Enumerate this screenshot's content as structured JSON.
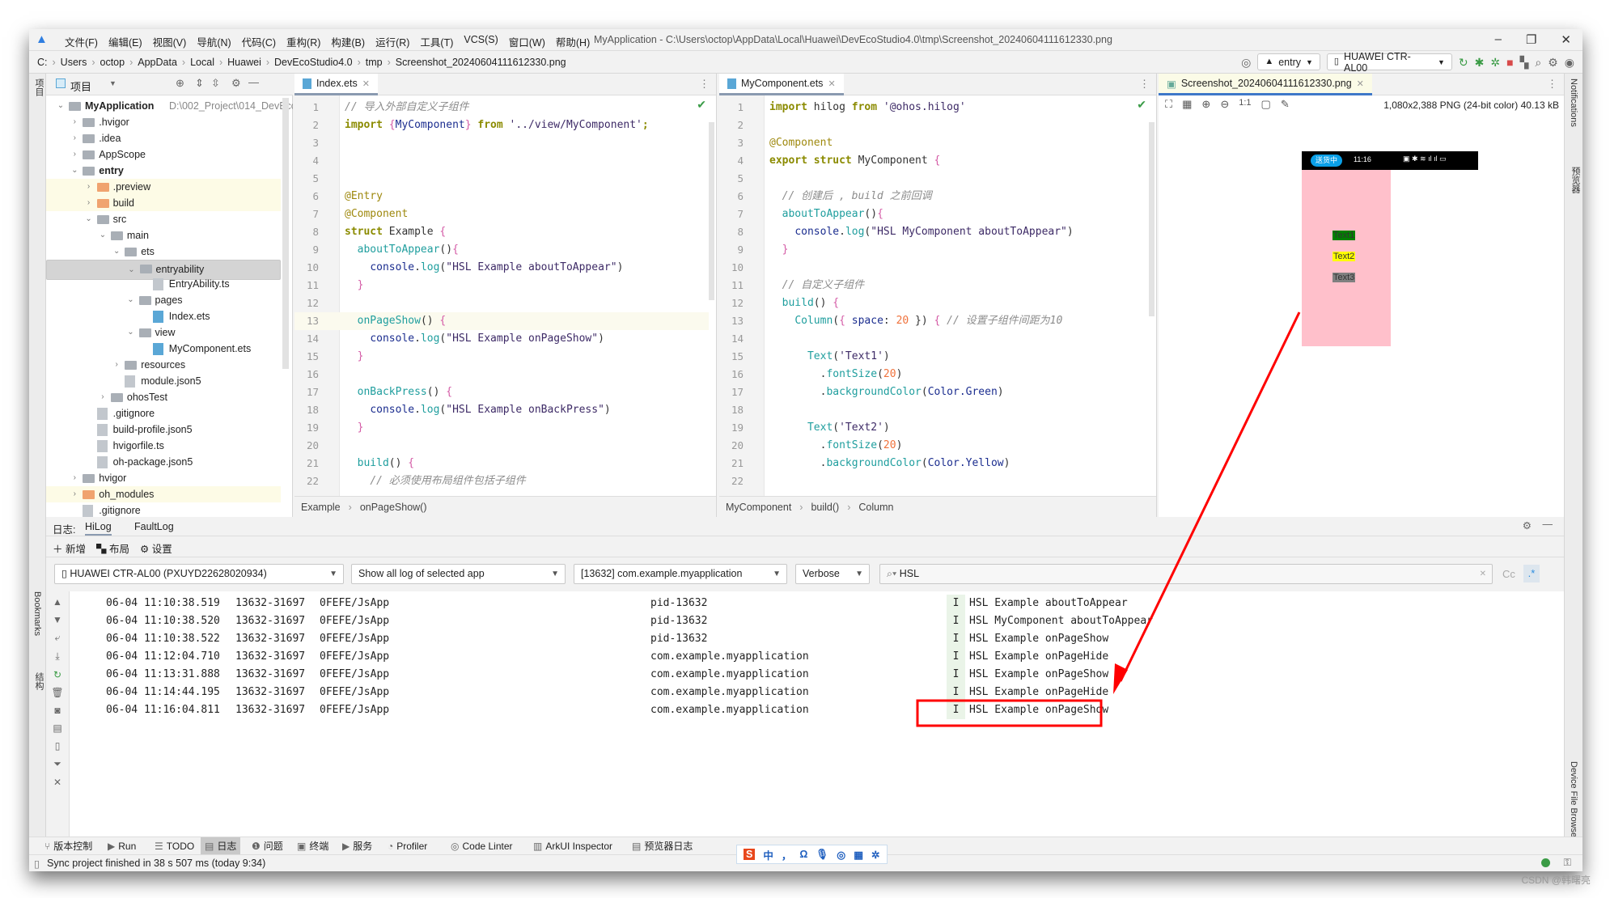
{
  "menu": [
    "文件(F)",
    "编辑(E)",
    "视图(V)",
    "导航(N)",
    "代码(C)",
    "重构(R)",
    "构建(B)",
    "运行(R)",
    "工具(T)",
    "VCS(S)",
    "窗口(W)",
    "帮助(H)"
  ],
  "window_title": "MyApplication - C:\\Users\\octop\\AppData\\Local\\Huawei\\DevEcoStudio4.0\\tmp\\Screenshot_20240604111612330.png",
  "breadcrumb": [
    "C:",
    "Users",
    "octop",
    "AppData",
    "Local",
    "Huawei",
    "DevEcoStudio4.0",
    "tmp",
    "Screenshot_20240604111612330.png"
  ],
  "run_config": "entry",
  "device": "HUAWEI CTR-AL00",
  "project_panel": {
    "title": "项目",
    "root_path": "D:\\002_Project\\014_DevEcoSt"
  },
  "tree": [
    {
      "label": "MyApplication",
      "level": 0,
      "type": "module",
      "open": true,
      "bold": true
    },
    {
      "label": ".hvigor",
      "level": 1,
      "type": "folder"
    },
    {
      "label": ".idea",
      "level": 1,
      "type": "folder"
    },
    {
      "label": "AppScope",
      "level": 1,
      "type": "folder"
    },
    {
      "label": "entry",
      "level": 1,
      "type": "module",
      "open": true,
      "bold": true
    },
    {
      "label": ".preview",
      "level": 2,
      "type": "folder-orange",
      "hl": true
    },
    {
      "label": "build",
      "level": 2,
      "type": "folder-orange",
      "hl": true
    },
    {
      "label": "src",
      "level": 2,
      "type": "folder",
      "open": true
    },
    {
      "label": "main",
      "level": 3,
      "type": "folder",
      "open": true
    },
    {
      "label": "ets",
      "level": 4,
      "type": "folder",
      "open": true
    },
    {
      "label": "entryability",
      "level": 5,
      "type": "folder",
      "open": true,
      "selected": true
    },
    {
      "label": "EntryAbility.ts",
      "level": 6,
      "type": "ts"
    },
    {
      "label": "pages",
      "level": 5,
      "type": "folder",
      "open": true
    },
    {
      "label": "Index.ets",
      "level": 6,
      "type": "ets"
    },
    {
      "label": "view",
      "level": 5,
      "type": "folder",
      "open": true
    },
    {
      "label": "MyComponent.ets",
      "level": 6,
      "type": "ets"
    },
    {
      "label": "resources",
      "level": 4,
      "type": "folder"
    },
    {
      "label": "module.json5",
      "level": 4,
      "type": "json"
    },
    {
      "label": "ohosTest",
      "level": 3,
      "type": "folder"
    },
    {
      "label": ".gitignore",
      "level": 2,
      "type": "file"
    },
    {
      "label": "build-profile.json5",
      "level": 2,
      "type": "json"
    },
    {
      "label": "hvigorfile.ts",
      "level": 2,
      "type": "ts"
    },
    {
      "label": "oh-package.json5",
      "level": 2,
      "type": "json"
    },
    {
      "label": "hvigor",
      "level": 1,
      "type": "folder"
    },
    {
      "label": "oh_modules",
      "level": 1,
      "type": "folder-orange",
      "hl": true
    },
    {
      "label": ".gitignore",
      "level": 1,
      "type": "file"
    }
  ],
  "editor1": {
    "tab": "Index.ets",
    "current_line": 13,
    "breadcrumb": [
      "Example",
      "onPageShow()"
    ],
    "lines": [
      [
        [
          "cm",
          "// 导入外部自定义子组件"
        ]
      ],
      [
        [
          "kw",
          "import "
        ],
        [
          "br",
          "{"
        ],
        [
          "pl",
          "MyComponent"
        ],
        [
          "br",
          "}"
        ],
        [
          "kw",
          " from "
        ],
        [
          "st",
          "'../view/MyComponent'"
        ],
        [
          "kw",
          ";"
        ]
      ],
      [],
      [],
      [],
      [
        [
          "an",
          "@Entry"
        ]
      ],
      [
        [
          "an",
          "@Component"
        ]
      ],
      [
        [
          "kw",
          "struct "
        ],
        [
          "tx",
          "Example "
        ],
        [
          "br",
          "{"
        ]
      ],
      [
        [
          "tx",
          "  "
        ],
        [
          "fn",
          "aboutToAppear"
        ],
        [
          "tx",
          "()"
        ],
        [
          "br",
          "{"
        ]
      ],
      [
        [
          "tx",
          "    "
        ],
        [
          "pl",
          "console"
        ],
        [
          "tx",
          "."
        ],
        [
          "fn",
          "log"
        ],
        [
          "tx",
          "("
        ],
        [
          "st",
          "\"HSL Example aboutToAppear\""
        ],
        [
          "tx",
          ")"
        ]
      ],
      [
        [
          "tx",
          "  "
        ],
        [
          "br",
          "}"
        ]
      ],
      [],
      [
        [
          "tx",
          "  "
        ],
        [
          "fn",
          "onPageShow"
        ],
        [
          "tx",
          "() "
        ],
        [
          "br",
          "{"
        ]
      ],
      [
        [
          "tx",
          "    "
        ],
        [
          "pl",
          "console"
        ],
        [
          "tx",
          "."
        ],
        [
          "fn",
          "log"
        ],
        [
          "tx",
          "("
        ],
        [
          "st",
          "\"HSL Example onPageShow\""
        ],
        [
          "tx",
          ")"
        ]
      ],
      [
        [
          "tx",
          "  "
        ],
        [
          "br",
          "}"
        ]
      ],
      [],
      [
        [
          "tx",
          "  "
        ],
        [
          "fn",
          "onBackPress"
        ],
        [
          "tx",
          "() "
        ],
        [
          "br",
          "{"
        ]
      ],
      [
        [
          "tx",
          "    "
        ],
        [
          "pl",
          "console"
        ],
        [
          "tx",
          "."
        ],
        [
          "fn",
          "log"
        ],
        [
          "tx",
          "("
        ],
        [
          "st",
          "\"HSL Example onBackPress\""
        ],
        [
          "tx",
          ")"
        ]
      ],
      [
        [
          "tx",
          "  "
        ],
        [
          "br",
          "}"
        ]
      ],
      [],
      [
        [
          "tx",
          "  "
        ],
        [
          "fn",
          "build"
        ],
        [
          "tx",
          "() "
        ],
        [
          "br",
          "{"
        ]
      ],
      [
        [
          "tx",
          "    "
        ],
        [
          "cm",
          "// 必须使用布局组件包括子组件"
        ]
      ]
    ]
  },
  "editor2": {
    "tab": "MyComponent.ets",
    "breadcrumb": [
      "MyComponent",
      "build()",
      "Column"
    ],
    "lines": [
      [
        [
          "kw",
          "import "
        ],
        [
          "tx",
          "hilog "
        ],
        [
          "kw",
          "from "
        ],
        [
          "st",
          "'@ohos.hilog'"
        ]
      ],
      [],
      [
        [
          "an",
          "@Component"
        ]
      ],
      [
        [
          "kw",
          "export struct "
        ],
        [
          "tx",
          "MyComponent "
        ],
        [
          "br",
          "{"
        ]
      ],
      [],
      [
        [
          "tx",
          "  "
        ],
        [
          "cm",
          "// 创建后 , build 之前回调"
        ]
      ],
      [
        [
          "tx",
          "  "
        ],
        [
          "fn",
          "aboutToAppear"
        ],
        [
          "tx",
          "()"
        ],
        [
          "br",
          "{"
        ]
      ],
      [
        [
          "tx",
          "    "
        ],
        [
          "pl",
          "console"
        ],
        [
          "tx",
          "."
        ],
        [
          "fn",
          "log"
        ],
        [
          "tx",
          "("
        ],
        [
          "st",
          "\"HSL MyComponent aboutToAppear\""
        ],
        [
          "tx",
          ")"
        ]
      ],
      [
        [
          "tx",
          "  "
        ],
        [
          "br",
          "}"
        ]
      ],
      [],
      [
        [
          "tx",
          "  "
        ],
        [
          "cm",
          "// 自定义子组件"
        ]
      ],
      [
        [
          "tx",
          "  "
        ],
        [
          "fn",
          "build"
        ],
        [
          "tx",
          "() "
        ],
        [
          "br",
          "{"
        ]
      ],
      [
        [
          "tx",
          "    "
        ],
        [
          "fn",
          "Column"
        ],
        [
          "tx",
          "("
        ],
        [
          "br",
          "{"
        ],
        [
          "pl",
          " space"
        ],
        [
          "tx",
          ": "
        ],
        [
          "nu",
          "20"
        ],
        [
          "tx",
          " }) "
        ],
        [
          "br",
          "{"
        ],
        [
          "cm",
          " // 设置子组件间距为10"
        ]
      ],
      [],
      [
        [
          "tx",
          "      "
        ],
        [
          "fn",
          "Text"
        ],
        [
          "tx",
          "("
        ],
        [
          "st",
          "'Text1'"
        ],
        [
          "tx",
          ")"
        ]
      ],
      [
        [
          "tx",
          "        ."
        ],
        [
          "fn",
          "fontSize"
        ],
        [
          "tx",
          "("
        ],
        [
          "nu",
          "20"
        ],
        [
          "tx",
          ")"
        ]
      ],
      [
        [
          "tx",
          "        ."
        ],
        [
          "fn",
          "backgroundColor"
        ],
        [
          "tx",
          "("
        ],
        [
          "pl",
          "Color.Green"
        ],
        [
          "tx",
          ")"
        ]
      ],
      [],
      [
        [
          "tx",
          "      "
        ],
        [
          "fn",
          "Text"
        ],
        [
          "tx",
          "("
        ],
        [
          "st",
          "'Text2'"
        ],
        [
          "tx",
          ")"
        ]
      ],
      [
        [
          "tx",
          "        ."
        ],
        [
          "fn",
          "fontSize"
        ],
        [
          "tx",
          "("
        ],
        [
          "nu",
          "20"
        ],
        [
          "tx",
          ")"
        ]
      ],
      [
        [
          "tx",
          "        ."
        ],
        [
          "fn",
          "backgroundColor"
        ],
        [
          "tx",
          "("
        ],
        [
          "pl",
          "Color.Yellow"
        ],
        [
          "tx",
          ")"
        ]
      ],
      []
    ]
  },
  "image_viewer": {
    "tab": "Screenshot_20240604111612330.png",
    "info": "1,080x2,388 PNG (24-bit color) 40.13 kB",
    "phone": {
      "status_pill": "送货中",
      "time": "11:16",
      "texts": [
        {
          "label": "Text1",
          "bg": "#008000"
        },
        {
          "label": "Text2",
          "bg": "#ffff00"
        },
        {
          "label": "Text3",
          "bg": "#808080"
        }
      ],
      "bg": "#ffc0cb"
    }
  },
  "right_strip": [
    "Notifications",
    "预览器",
    "Device File Browser"
  ],
  "left_strip": [
    "项目",
    "Bookmarks",
    "结构"
  ],
  "log": {
    "label": "日志:",
    "tabs": [
      "HiLog",
      "FaultLog"
    ],
    "toolbar": [
      "新增",
      "布局",
      "设置"
    ],
    "device_filter": "HUAWEI CTR-AL00 (PXUYD22628020934)",
    "scope_filter": "Show all log of selected app",
    "process_filter": "[13632] com.example.myapplication",
    "level_filter": "Verbose",
    "search": "HSL",
    "case_btn": "Cc",
    "regex_btn": ".*",
    "rows": [
      {
        "time": "06-04 11:10:38.519",
        "pid": "13632-31697",
        "tag": "0FEFE/JsApp",
        "pkg": "pid-13632",
        "level": "I",
        "msg": "HSL Example aboutToAppear"
      },
      {
        "time": "06-04 11:10:38.520",
        "pid": "13632-31697",
        "tag": "0FEFE/JsApp",
        "pkg": "pid-13632",
        "level": "I",
        "msg": "HSL MyComponent aboutToAppear"
      },
      {
        "time": "06-04 11:10:38.522",
        "pid": "13632-31697",
        "tag": "0FEFE/JsApp",
        "pkg": "pid-13632",
        "level": "I",
        "msg": "HSL Example onPageShow"
      },
      {
        "time": "06-04 11:12:04.710",
        "pid": "13632-31697",
        "tag": "0FEFE/JsApp",
        "pkg": "com.example.myapplication",
        "level": "I",
        "msg": "HSL Example onPageHide"
      },
      {
        "time": "06-04 11:13:31.888",
        "pid": "13632-31697",
        "tag": "0FEFE/JsApp",
        "pkg": "com.example.myapplication",
        "level": "I",
        "msg": "HSL Example onPageShow"
      },
      {
        "time": "06-04 11:14:44.195",
        "pid": "13632-31697",
        "tag": "0FEFE/JsApp",
        "pkg": "com.example.myapplication",
        "level": "I",
        "msg": "HSL Example onPageHide"
      },
      {
        "time": "06-04 11:16:04.811",
        "pid": "13632-31697",
        "tag": "0FEFE/JsApp",
        "pkg": "com.example.myapplication",
        "level": "I",
        "msg": "HSL Example onPageShow",
        "highlighted": true
      }
    ]
  },
  "bottom_tabs": [
    "版本控制",
    "Run",
    "TODO",
    "日志",
    "问题",
    "终端",
    "服务",
    "Profiler",
    "Code Linter",
    "ArkUI Inspector",
    "预览器日志"
  ],
  "active_bottom_tab": "日志",
  "status": "Sync project finished in 38 s 507 ms (today 9:34)",
  "ime": [
    "中",
    "，",
    "Ω"
  ],
  "watermark": "CSDN @韩曙亮",
  "annotation_color": "#ff0000"
}
